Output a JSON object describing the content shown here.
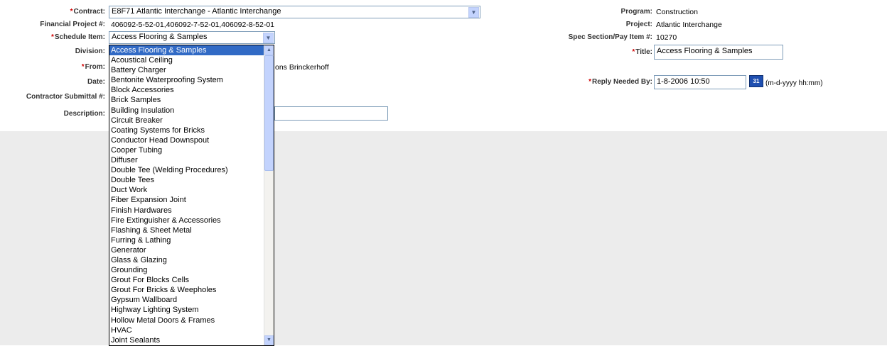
{
  "left_form": {
    "contract": {
      "label": "Contract:",
      "value": "E8F71 Atlantic Interchange - Atlantic Interchange"
    },
    "financial_project": {
      "label": "Financial Project #:",
      "value": "406092-5-52-01,406092-7-52-01,406092-8-52-01"
    },
    "schedule_item": {
      "label": "Schedule Item:",
      "value": "Access Flooring & Samples"
    },
    "division": {
      "label": "Division:"
    },
    "from": {
      "label": "From:",
      "value_partial": "ons Brinckerhoff"
    },
    "date": {
      "label": "Date:"
    },
    "contractor_submittal": {
      "label": "Contractor Submittal #:"
    },
    "description": {
      "label": "Description:",
      "value": ""
    }
  },
  "right_form": {
    "program": {
      "label": "Program:",
      "value": "Construction"
    },
    "project": {
      "label": "Project:",
      "value": "Atlantic Interchange"
    },
    "spec_section": {
      "label": "Spec Section/Pay Item #:",
      "value": "10270"
    },
    "title": {
      "label": "Title:",
      "value": "Access Flooring & Samples"
    },
    "reply_needed_by": {
      "label": "Reply Needed By:",
      "value": "1-8-2006 10:50",
      "format_hint": "(m-d-yyyy hh:mm)"
    }
  },
  "required_marker": "*",
  "schedule_dropdown": {
    "selected_index": 0,
    "options": [
      "Access Flooring & Samples",
      "Acoustical Ceiling",
      "Battery Charger",
      "Bentonite Waterproofing System",
      "Block Accessories",
      "Brick Samples",
      "Building Insulation",
      "Circuit Breaker",
      "Coating Systems for Bricks",
      "Conductor Head Downspout",
      "Cooper Tubing",
      "Diffuser",
      "Double Tee (Welding Procedures)",
      "Double Tees",
      "Duct Work",
      "Fiber Expansion Joint",
      "Finish Hardwares",
      "Fire Extinguisher & Accessories",
      "Flashing & Sheet Metal",
      "Furring & Lathing",
      "Generator",
      "Glass & Glazing",
      "Grounding",
      "Grout For Blocks Cells",
      "Grout For Bricks & Weepholes",
      "Gypsum Wallboard",
      "Highway Lighting System",
      "Hollow Metal Doors & Frames",
      "HVAC",
      "Joint Sealants"
    ]
  },
  "icons": {
    "dropdown_arrow": "chevron-down-icon",
    "calendar": "calendar-icon"
  }
}
